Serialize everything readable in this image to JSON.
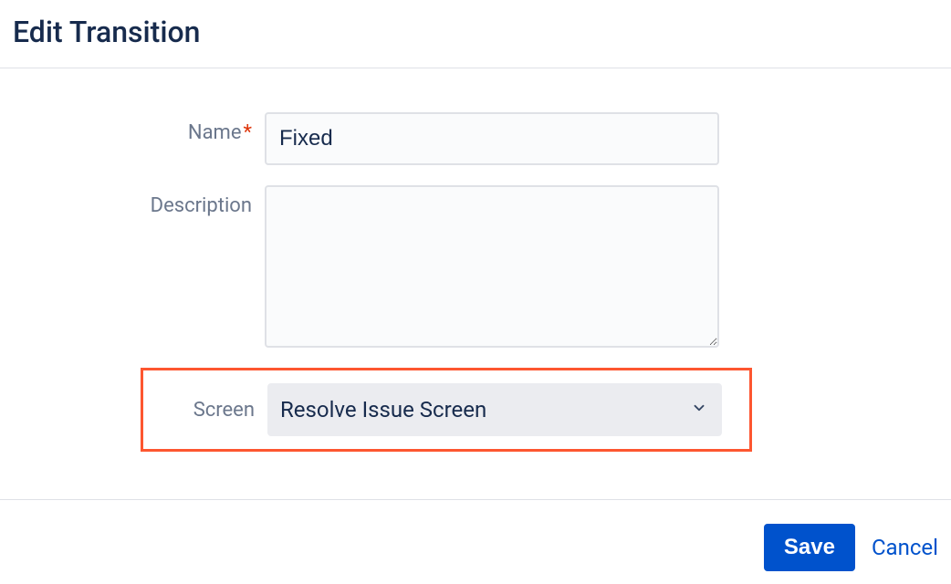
{
  "dialog": {
    "title": "Edit Transition"
  },
  "form": {
    "name": {
      "label": "Name",
      "value": "Fixed"
    },
    "description": {
      "label": "Description",
      "value": ""
    },
    "screen": {
      "label": "Screen",
      "selected": "Resolve Issue Screen"
    }
  },
  "actions": {
    "save": "Save",
    "cancel": "Cancel"
  }
}
